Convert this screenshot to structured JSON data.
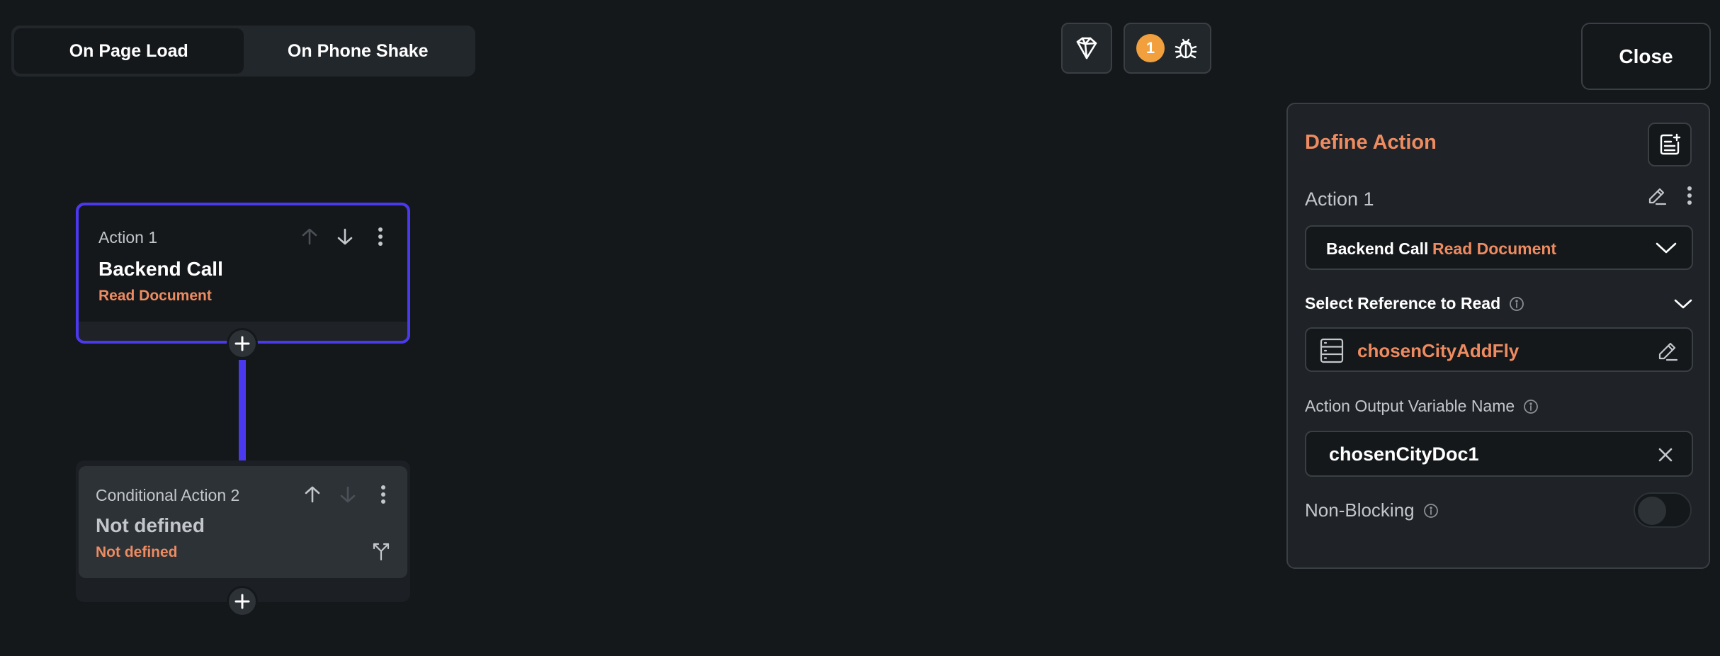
{
  "trigger_tabs": [
    {
      "label": "On Page Load",
      "active": true
    },
    {
      "label": "On Phone Shake",
      "active": false
    }
  ],
  "toolbar": {
    "icon_1": "magic-wand-icon",
    "issues_count": "1",
    "issues_icon": "bug-icon",
    "close_label": "Close"
  },
  "actions": [
    {
      "label": "Action 1",
      "title": "Backend Call",
      "subtitle": "Read Document"
    },
    {
      "label": "Conditional Action 2",
      "title": "Not defined",
      "subtitle": "Not defined"
    }
  ],
  "panel": {
    "title": "Define Action",
    "action_name": "Action 1",
    "action_type": "Backend Call",
    "action_subtype": "Read Document",
    "reference_label": "Select Reference to Read",
    "reference_value": "chosenCityAddFly",
    "output_label": "Action Output Variable Name",
    "output_value": "chosenCityDoc1",
    "non_blocking_label": "Non-Blocking",
    "non_blocking_on": false
  },
  "colors": {
    "accent": "#4b39ef",
    "secondary": "#ee8b60",
    "warning": "#f2a03d",
    "background": "#14181b"
  }
}
